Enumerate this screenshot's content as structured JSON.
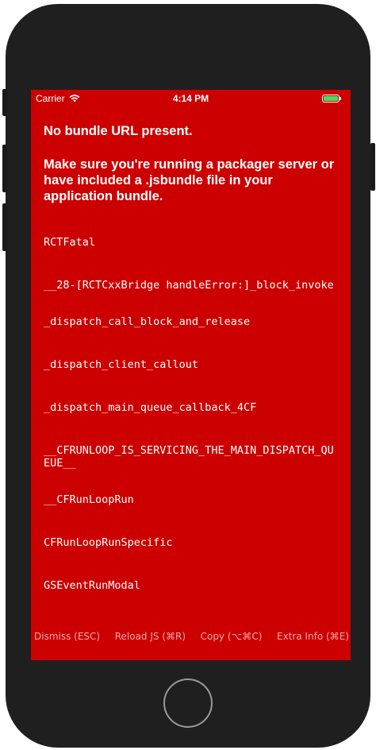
{
  "status_bar": {
    "carrier": "Carrier",
    "time": "4:14 PM",
    "battery_color": "#4cd964",
    "wifi_icon": "wifi-icon",
    "battery_icon": "battery-icon"
  },
  "redbox": {
    "background_color": "#cc0000",
    "title": "No bundle URL present.",
    "message": "Make sure you're running a packager server or have included a .jsbundle file in your application bundle.",
    "stack": [
      "RCTFatal",
      "__28-[RCTCxxBridge handleError:]_block_invoke",
      "_dispatch_call_block_and_release",
      "_dispatch_client_callout",
      "_dispatch_main_queue_callback_4CF",
      "__CFRUNLOOP_IS_SERVICING_THE_MAIN_DISPATCH_QUEUE__",
      "__CFRunLoopRun",
      "CFRunLoopRunSpecific",
      "GSEventRunModal"
    ],
    "buttons": {
      "dismiss": "Dismiss (ESC)",
      "reload": "Reload JS (⌘R)",
      "copy": "Copy (⌥⌘C)",
      "extra_info": "Extra Info (⌘E)"
    }
  },
  "device": {
    "home_button_icon": "home-button-icon"
  }
}
